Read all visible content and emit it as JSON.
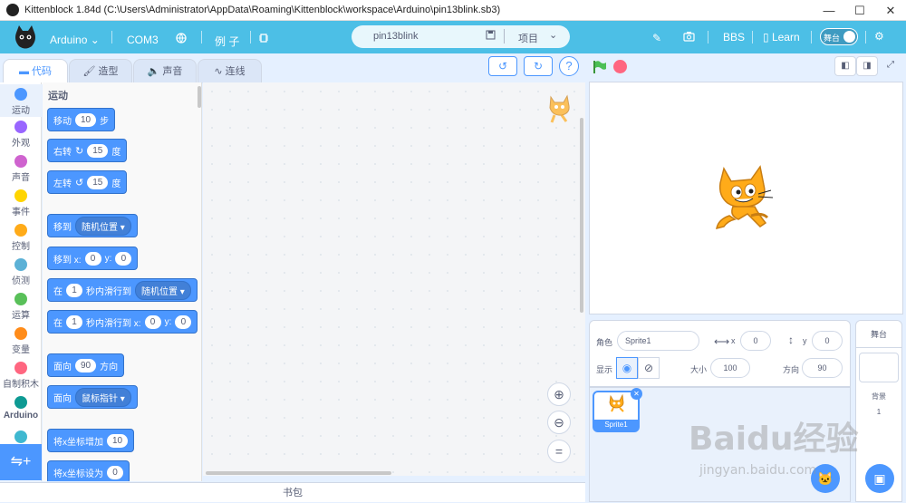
{
  "window": {
    "title": "Kittenblock 1.84d (C:\\Users\\Administrator\\AppData\\Roaming\\Kittenblock\\workspace\\Arduino\\pin13blink.sb3)",
    "minimize": "—",
    "maximize": "☐",
    "close": "✕"
  },
  "menu": {
    "board": "Arduino",
    "port": "COM3",
    "examples": "例 子",
    "project_name": "pin13blink",
    "project_menu": "项目",
    "bbs": "BBS",
    "learn": "Learn",
    "stage_toggle": "舞台"
  },
  "tabs": [
    {
      "label": "代码",
      "active": true
    },
    {
      "label": "造型",
      "active": false
    },
    {
      "label": "声音",
      "active": false
    },
    {
      "label": "连线",
      "active": false
    }
  ],
  "categories": [
    {
      "label": "运动",
      "color": "#4c97ff",
      "active": true
    },
    {
      "label": "外观",
      "color": "#9966ff"
    },
    {
      "label": "声音",
      "color": "#cf63cf"
    },
    {
      "label": "事件",
      "color": "#ffd500"
    },
    {
      "label": "控制",
      "color": "#ffab19"
    },
    {
      "label": "侦测",
      "color": "#5cb1d6"
    },
    {
      "label": "运算",
      "color": "#59c059"
    },
    {
      "label": "变量",
      "color": "#ff8c1a"
    },
    {
      "label": "自制积木",
      "color": "#ff6680"
    },
    {
      "label": "Arduino",
      "color": "#0e9a93"
    }
  ],
  "palette": {
    "heading": "运动",
    "move": {
      "pre": "移动",
      "val": "10",
      "post": "步"
    },
    "turn_right": {
      "pre": "右转",
      "val": "15",
      "post": "度"
    },
    "turn_left": {
      "pre": "左转",
      "val": "15",
      "post": "度"
    },
    "goto": {
      "pre": "移到",
      "drop": "随机位置"
    },
    "goto_xy": {
      "pre": "移到 x:",
      "x": "0",
      "mid": "y:",
      "y": "0"
    },
    "glide": {
      "pre": "在",
      "val": "1",
      "mid": "秒内滑行到",
      "drop": "随机位置"
    },
    "glide_xy": {
      "pre": "在",
      "val": "1",
      "mid": "秒内滑行到 x:",
      "x": "0",
      "mid2": "y:",
      "y": "0"
    },
    "point": {
      "pre": "面向",
      "val": "90",
      "post": "方向"
    },
    "point_towards": {
      "pre": "面向",
      "drop": "鼠标指针"
    },
    "change_x": {
      "pre": "将x坐标增加",
      "val": "10"
    },
    "set_x": {
      "pre": "将x坐标设为",
      "val": "0"
    }
  },
  "backpack": "书包",
  "sprite_info": {
    "sprite_label": "角色",
    "sprite_name": "Sprite1",
    "x_label": "x",
    "x": "0",
    "y_label": "y",
    "y": "0",
    "show_label": "显示",
    "size_label": "大小",
    "size": "100",
    "direction_label": "方向",
    "direction": "90"
  },
  "sprites": [
    {
      "name": "Sprite1"
    }
  ],
  "stage_panel": {
    "title": "舞台",
    "backdrop_label": "背景",
    "backdrop_count": "1"
  },
  "watermark": {
    "text": "Baidu经验",
    "url": "jingyan.baidu.com"
  }
}
